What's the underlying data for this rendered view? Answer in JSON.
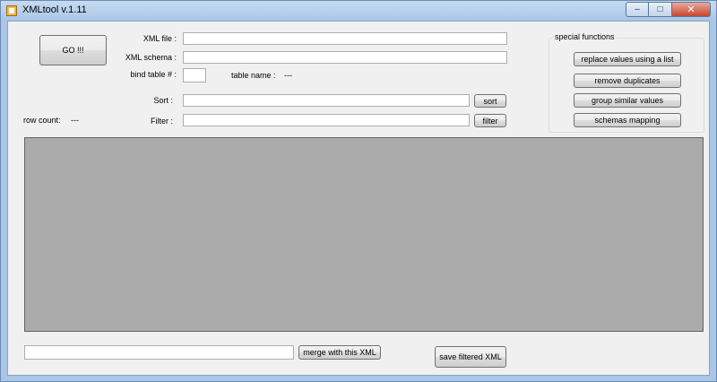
{
  "window": {
    "title": "XMLtool v.1.11",
    "controls": {
      "minimize": "–",
      "maximize": "□",
      "close": "✕"
    }
  },
  "main": {
    "go_label": "GO !!!",
    "xml_file_label": "XML file :",
    "xml_file_value": "",
    "xml_schema_label": "XML schema :",
    "xml_schema_value": "",
    "bind_table_label": "bind table # :",
    "bind_table_value": "",
    "table_name_label": "table name :",
    "table_name_value": "---",
    "sort_label": "Sort :",
    "sort_value": "",
    "sort_button": "sort",
    "filter_label": "Filter :",
    "filter_value": "",
    "filter_button": "filter",
    "row_count_label": "row count:",
    "row_count_value": "---"
  },
  "special_functions": {
    "title": "special functions",
    "buttons": [
      "replace values using a list",
      "remove duplicates",
      "group similar values",
      "schemas mapping"
    ]
  },
  "bottom": {
    "merge_value": "",
    "merge_button": "merge with this XML",
    "save_button": "save filtered XML"
  },
  "colors": {
    "grid_background": "#ababab",
    "client_background": "#f0f0f0"
  }
}
